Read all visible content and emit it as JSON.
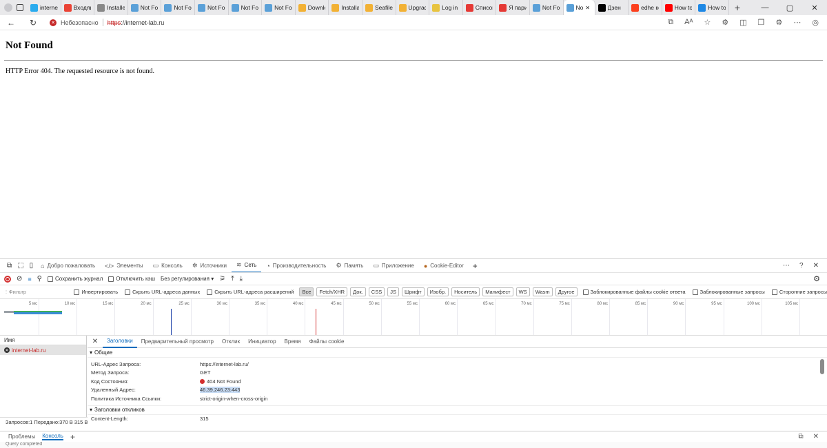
{
  "browser": {
    "tabs": [
      {
        "label": "internet",
        "icon": "telegram-icon",
        "color": "#2aabee"
      },
      {
        "label": "Входящ",
        "icon": "gmail-icon",
        "color": "#ea4335"
      },
      {
        "label": "Installer",
        "icon": "page-icon",
        "color": "#888888"
      },
      {
        "label": "Not Fou",
        "icon": "iis-icon",
        "color": "#5aa0d8"
      },
      {
        "label": "Not Fou",
        "icon": "iis-icon",
        "color": "#5aa0d8"
      },
      {
        "label": "Not Fou",
        "icon": "iis-icon",
        "color": "#5aa0d8"
      },
      {
        "label": "Not Fou",
        "icon": "iis-icon",
        "color": "#5aa0d8"
      },
      {
        "label": "Not Fou",
        "icon": "iis-icon",
        "color": "#5aa0d8"
      },
      {
        "label": "Downlo",
        "icon": "seafile-icon",
        "color": "#f2b134"
      },
      {
        "label": "Installat",
        "icon": "seafile-icon",
        "color": "#f2b134"
      },
      {
        "label": "Seafile",
        "icon": "seafile-icon",
        "color": "#f2b134"
      },
      {
        "label": "Upgrad",
        "icon": "seafile-icon",
        "color": "#f2b134"
      },
      {
        "label": "Log in",
        "icon": "pencil-icon",
        "color": "#e8c440"
      },
      {
        "label": "Список",
        "icon": "a-icon",
        "color": "#e53935"
      },
      {
        "label": "Я пари",
        "icon": "a-icon",
        "color": "#e53935"
      },
      {
        "label": "Not Fou",
        "icon": "iis-icon",
        "color": "#5aa0d8"
      }
    ],
    "active_tab": {
      "label": "No",
      "close": "✕"
    },
    "tabs_after": [
      {
        "label": "Дзен",
        "icon": "dzen-icon",
        "color": "#000000"
      },
      {
        "label": "edhe ко",
        "icon": "yandex-icon",
        "color": "#fc3f1d"
      },
      {
        "label": "How to",
        "icon": "youtube-icon",
        "color": "#ff0000"
      },
      {
        "label": "How to",
        "icon": "ss-icon",
        "color": "#1e88e5"
      }
    ],
    "new_tab": "+",
    "window_controls": [
      "—",
      "▢",
      "✕"
    ],
    "address": {
      "insecure_label": "Небезопасно",
      "scheme": "https",
      "rest": "://internet-lab.ru"
    }
  },
  "page": {
    "title": "Not Found",
    "message": "HTTP Error 404. The requested resource is not found."
  },
  "devtools": {
    "tabs": [
      {
        "label": "Добро пожаловать",
        "icon": "home-icon"
      },
      {
        "label": "Элементы",
        "icon": "code-icon"
      },
      {
        "label": "Консоль",
        "icon": "console-icon"
      },
      {
        "label": "Источники",
        "icon": "bug-icon"
      },
      {
        "label": "Сеть",
        "icon": "wifi-icon",
        "active": true
      },
      {
        "label": "Производительность",
        "icon": "gauge-icon"
      },
      {
        "label": "Память",
        "icon": "memory-icon"
      },
      {
        "label": "Приложение",
        "icon": "app-icon"
      },
      {
        "label": "Cookie-Editor",
        "icon": "cookie-icon"
      }
    ],
    "toolbar": {
      "preserve_log": "Сохранить журнал",
      "disable_cache": "Отключить кэш",
      "throttle": "Без регулирования"
    },
    "filter": {
      "placeholder": "Фильтр",
      "invert": "Инвертировать",
      "hide_data_urls": "Скрыть URL-адреса данных",
      "hide_ext_urls": "Скрыть URL-адреса расширений",
      "chips": [
        "Все",
        "Fetch/XHR",
        "Док.",
        "CSS",
        "JS",
        "Шрифт",
        "Изобр.",
        "Носитель",
        "Манифест",
        "WS",
        "Wasm",
        "Другое"
      ],
      "blocked_cookies": "Заблокированные файлы cookie ответа",
      "blocked_requests": "Заблокированные запросы",
      "third_party": "Сторонние запросы"
    },
    "timeline": {
      "ticks": [
        "5 мс",
        "10 мс",
        "15 мс",
        "20 мс",
        "25 мс",
        "30 мс",
        "35 мс",
        "40 мс",
        "45 мс",
        "50 мс",
        "55 мс",
        "60 мс",
        "65 мс",
        "70 мс",
        "75 мс",
        "80 мс",
        "85 мс",
        "90 мс",
        "95 мс",
        "100 мс",
        "105 мс"
      ]
    },
    "requests": {
      "column": "Имя",
      "items": [
        "internet-lab.ru"
      ]
    },
    "details": {
      "tabs": [
        "Заголовки",
        "Предварительный просмотр",
        "Отклик",
        "Инициатор",
        "Время",
        "Файлы cookie"
      ],
      "general_title": "Общие",
      "general": [
        {
          "k": "URL-Адрес Запроса:",
          "v": "https://internet-lab.ru/"
        },
        {
          "k": "Метод Запроса:",
          "v": "GET"
        },
        {
          "k": "Код Состояния:",
          "v": "404 Not Found"
        },
        {
          "k": "Удаленный Адрес:",
          "v": "46.39.246.23:443"
        },
        {
          "k": "Политика Источника Ссылки:",
          "v": "strict-origin-when-cross-origin"
        }
      ],
      "response_title": "Заголовки откликов",
      "response": [
        {
          "k": "Content-Length:",
          "v": "315"
        }
      ]
    },
    "status": "Запросов:1  Передано:370 B  315 B",
    "drawer": {
      "tabs": [
        "Проблемы",
        "Консоль"
      ],
      "bottom": "Query completed"
    }
  }
}
